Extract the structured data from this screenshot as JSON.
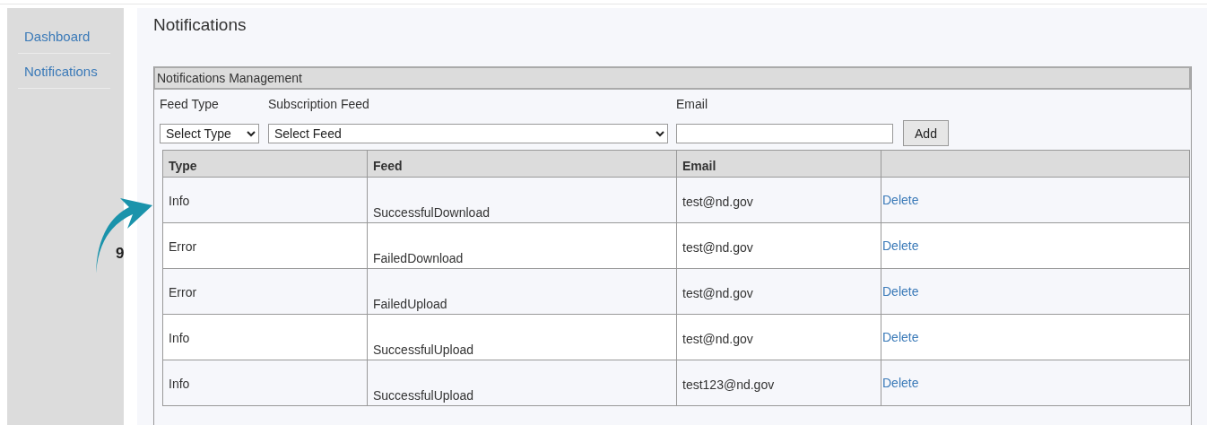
{
  "sidebar": {
    "items": [
      {
        "label": "Dashboard"
      },
      {
        "label": "Notifications"
      }
    ]
  },
  "page_title": "Notifications",
  "panel": {
    "title": "Notifications Management",
    "form": {
      "feed_type": {
        "label": "Feed Type",
        "value": "Select Type"
      },
      "subscription_feed": {
        "label": "Subscription Feed",
        "value": "Select Feed"
      },
      "email": {
        "label": "Email"
      },
      "add_button": "Add"
    },
    "table": {
      "columns": [
        "Type",
        "Feed",
        "Email"
      ],
      "rows": [
        {
          "type": "Info",
          "feed": "SuccessfulDownload",
          "email": "test@nd.gov",
          "action": "Delete"
        },
        {
          "type": "Error",
          "feed": "FailedDownload",
          "email": "test@nd.gov",
          "action": "Delete"
        },
        {
          "type": "Error",
          "feed": "FailedUpload",
          "email": "test@nd.gov",
          "action": "Delete"
        },
        {
          "type": "Info",
          "feed": "SuccessfulUpload",
          "email": "test@nd.gov",
          "action": "Delete"
        },
        {
          "type": "Info",
          "feed": "SuccessfulUpload",
          "email": "test123@nd.gov",
          "action": "Delete"
        }
      ]
    }
  },
  "callout": {
    "label": "9"
  }
}
